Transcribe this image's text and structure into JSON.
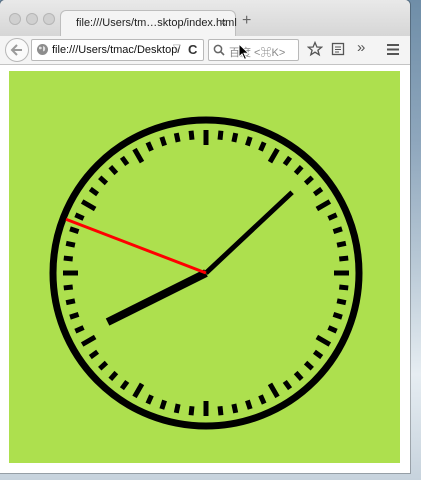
{
  "window": {
    "tab_title": "file:///Users/tm…sktop/index.html",
    "tab_close": "×",
    "new_tab": "+"
  },
  "toolbar": {
    "url": "file:///Users/tmac/Desktop/",
    "url_dropdown": "▽",
    "reload": "C",
    "search_placeholder": "百度 <⌘K>",
    "overflow": "»"
  },
  "clock": {
    "background_color": "#ade04e",
    "face_color": "#000000",
    "second_hand_color": "#ff0000",
    "hour": 8,
    "minute": 7,
    "second": 48.5
  },
  "colors": {
    "page_background": "#ffffff",
    "chrome_background": "#f4f4f4"
  }
}
